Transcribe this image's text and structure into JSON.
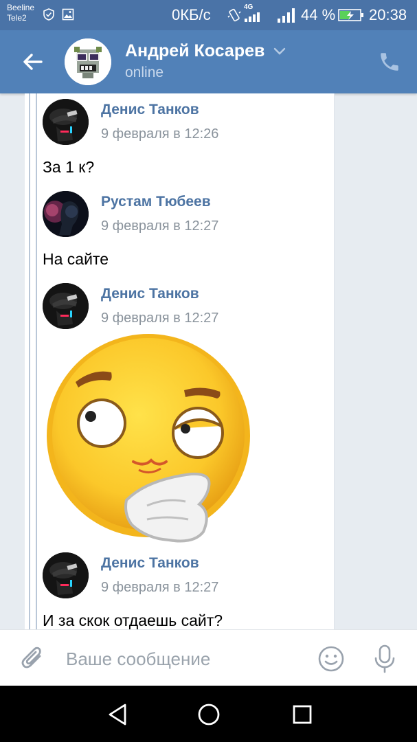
{
  "status_bar": {
    "carrier_1": "Beeline",
    "carrier_2": "Tele2",
    "data_speed": "0КБ/с",
    "network": "4G",
    "battery": "44 %",
    "time": "20:38"
  },
  "header": {
    "contact_name": "Андрей Косарев",
    "status": "online"
  },
  "messages": [
    {
      "author": "Денис Танков",
      "time": "9 февраля в 12:26",
      "text": "За 1 к?"
    },
    {
      "author": "Рустам Тюбеев",
      "time": "9 февраля в 12:27",
      "text": "На сайте"
    },
    {
      "author": "Денис Танков",
      "time": "9 февраля в 12:27",
      "sticker": "thinking-face-sticker"
    },
    {
      "author": "Денис Танков",
      "time": "9 февраля в 12:27",
      "text": "И за скок отдаешь сайт?"
    }
  ],
  "composer": {
    "placeholder": "Ваше сообщение"
  },
  "colors": {
    "header": "#5181b8",
    "status_bar": "#4a73a7",
    "author": "#4d74a3",
    "timestamp": "#8a939c"
  }
}
